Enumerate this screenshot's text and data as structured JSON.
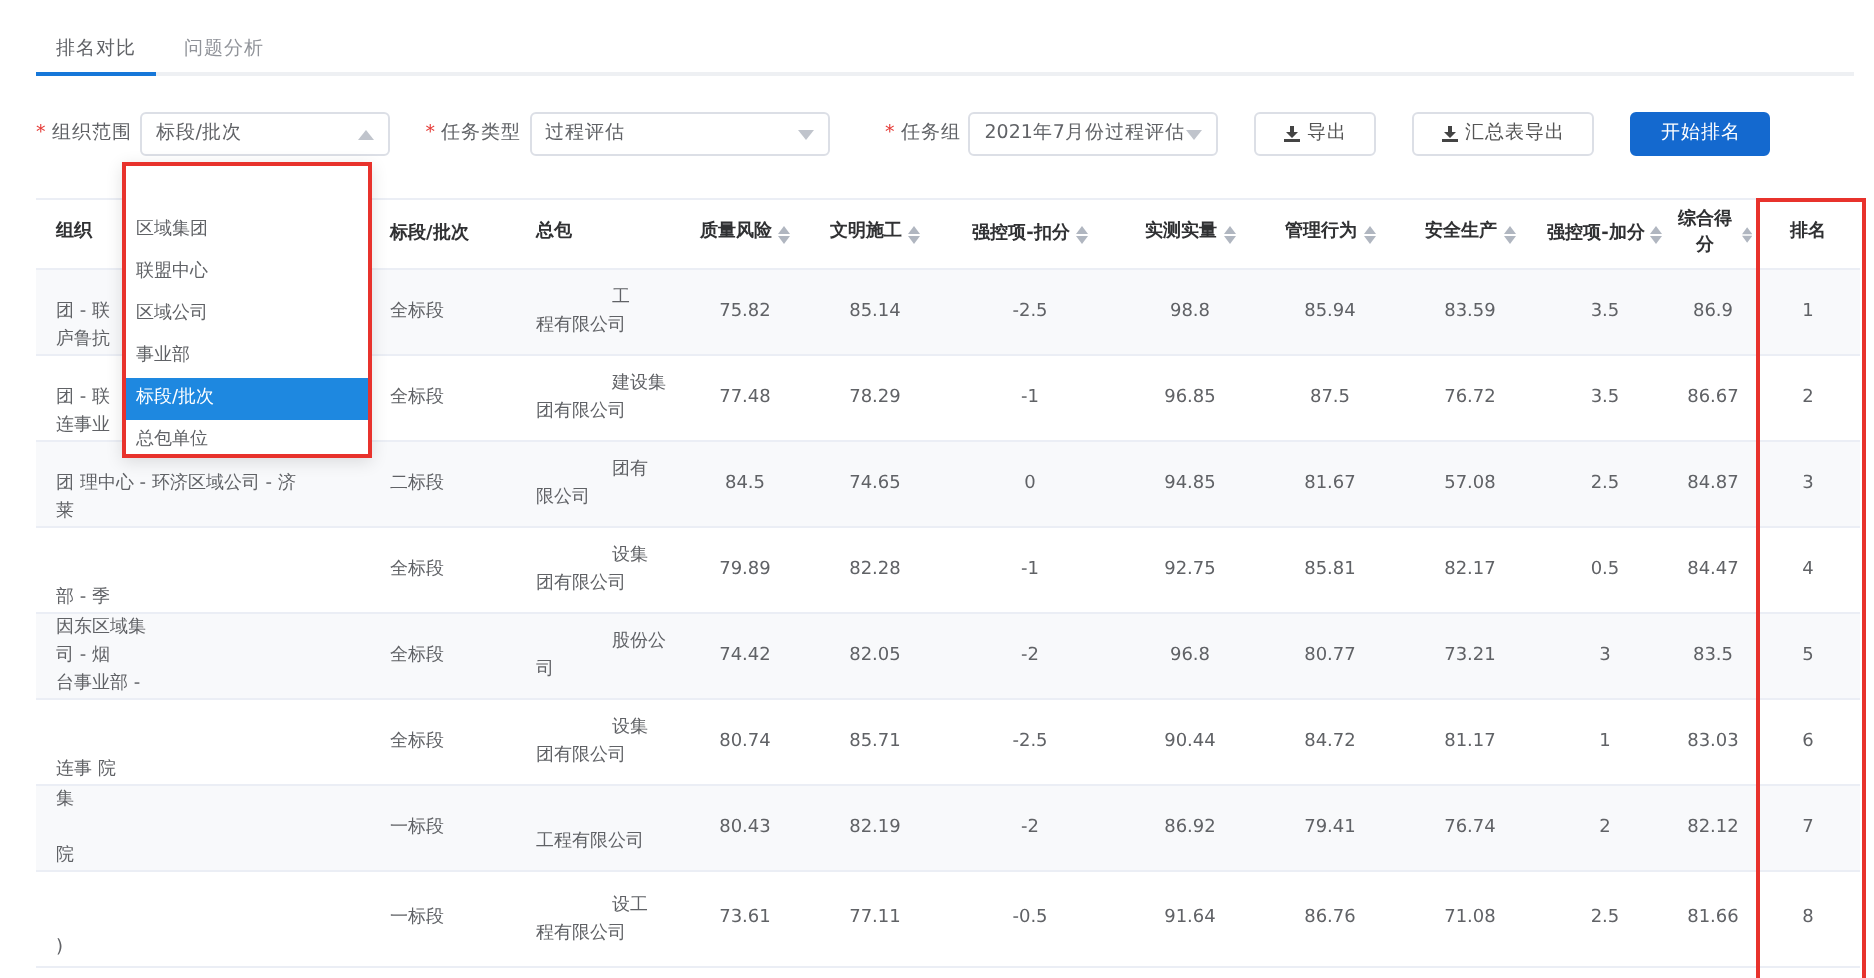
{
  "tabs": [
    {
      "label": "排名对比",
      "selected": true
    },
    {
      "label": "问题分析",
      "selected": false
    }
  ],
  "filters": [
    {
      "marker": "*",
      "label": "组织范围",
      "value": "标段/批次",
      "open": true
    },
    {
      "marker": "*",
      "label": "任务类型",
      "value": "过程评估",
      "open": false
    },
    {
      "marker": "*",
      "label": "任务组",
      "value": "2021年7月份过程评估",
      "open": false
    }
  ],
  "buttons": [
    {
      "label": "导出",
      "kind": "export"
    },
    {
      "label": "汇总表导出",
      "kind": "export"
    },
    {
      "label": "开始排名",
      "kind": "primary"
    }
  ],
  "dropdown": {
    "items": [
      {
        "label": "区域集团",
        "selected": false
      },
      {
        "label": "联盟中心",
        "selected": false
      },
      {
        "label": "区域公司",
        "selected": false
      },
      {
        "label": "事业部",
        "selected": false
      },
      {
        "label": "标段/批次",
        "selected": true
      },
      {
        "label": "总包单位",
        "selected": false
      }
    ]
  },
  "table": {
    "columns": [
      {
        "label": "组织",
        "sortable": false
      },
      {
        "label": "标段/批次",
        "sortable": false
      },
      {
        "label": "总包",
        "sortable": false
      },
      {
        "label": "质量风险",
        "sortable": true
      },
      {
        "label": "文明施工",
        "sortable": true
      },
      {
        "label": "强控项-扣分",
        "sortable": true
      },
      {
        "label": "实测实量",
        "sortable": true
      },
      {
        "label": "管理行为",
        "sortable": true
      },
      {
        "label": "安全生产",
        "sortable": true
      },
      {
        "label": "强控项-加分",
        "sortable": true
      },
      {
        "label": "综合得分",
        "sortable": true
      },
      {
        "label": "排名",
        "sortable": false
      }
    ],
    "rows": [
      {
        "cells": [
          {
            "middle": "团 - 联",
            "bottom": "庐鲁抗"
          },
          "全标段",
          {
            "top": "工",
            "bottom": "程有限公司"
          },
          "75.82",
          "85.14",
          "-2.5",
          "98.8",
          "85.94",
          "83.59",
          "3.5",
          "86.9",
          "1"
        ]
      },
      {
        "cells": [
          {
            "middle": "团 - 联",
            "bottom": "连事业"
          },
          "全标段",
          {
            "top": "建设集",
            "bottom": "团有限公司"
          },
          "77.48",
          "78.29",
          "-1",
          "96.85",
          "87.5",
          "76.72",
          "3.5",
          "86.67",
          "2"
        ]
      },
      {
        "cells": [
          {
            "middle": "团 理中心 - 环济区域公司 - 济",
            "bottom": "莱"
          },
          "二标段",
          {
            "top": "团有",
            "bottom": "限公司"
          },
          "84.5",
          "74.65",
          "0",
          "94.85",
          "81.67",
          "57.08",
          "2.5",
          "84.87",
          "3"
        ]
      },
      {
        "cells": [
          {
            "bottom": "部 - 季"
          },
          "全标段",
          {
            "top": "设集",
            "bottom": "团有限公司"
          },
          "79.89",
          "82.28",
          "-1",
          "92.75",
          "85.81",
          "82.17",
          "0.5",
          "84.47",
          "4"
        ]
      },
      {
        "cells": [
          {
            "top": "因东区域集",
            "middle": "司 - 烟",
            "bottom": "台事业部 -"
          },
          "全标段",
          {
            "top": "股份公",
            "bottom": "司"
          },
          "74.42",
          "82.05",
          "-2",
          "96.8",
          "80.77",
          "73.21",
          "3",
          "83.5",
          "5"
        ]
      },
      {
        "cells": [
          {
            "bottom": "连事 院"
          },
          "全标段",
          {
            "top": "设集",
            "bottom": "团有限公司"
          },
          "80.74",
          "85.71",
          "-2.5",
          "90.44",
          "84.72",
          "81.17",
          "1",
          "83.03",
          "6"
        ]
      },
      {
        "cells": [
          {
            "top": "集",
            "bottom": "院"
          },
          "一标段",
          {
            "bottom": "工程有限公司"
          },
          "80.43",
          "82.19",
          "-2",
          "86.92",
          "79.41",
          "76.74",
          "2",
          "82.12",
          "7"
        ]
      },
      {
        "cells": [
          {
            "bottom": ")"
          },
          "一标段",
          {
            "top": "设工",
            "bottom": "程有限公司"
          },
          "73.61",
          "77.11",
          "-0.5",
          "91.64",
          "86.76",
          "71.08",
          "2.5",
          "81.66",
          "8"
        ]
      }
    ]
  }
}
